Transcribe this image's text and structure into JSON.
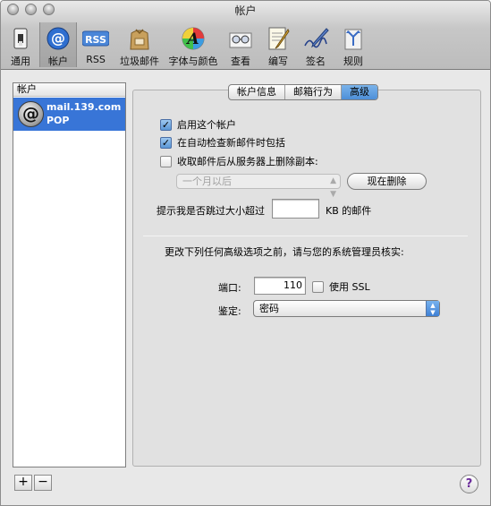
{
  "window": {
    "title": "帐户"
  },
  "toolbar": {
    "items": [
      {
        "label": "通用",
        "icon": "switch-icon"
      },
      {
        "label": "帐户",
        "icon": "at-sign-icon",
        "selected": true
      },
      {
        "label": "RSS",
        "icon": "rss-icon",
        "badge": "RSS"
      },
      {
        "label": "垃圾邮件",
        "icon": "junk-bag-icon"
      },
      {
        "label": "字体与颜色",
        "icon": "fonts-colors-icon",
        "glyph": "A"
      },
      {
        "label": "查看",
        "icon": "glasses-icon"
      },
      {
        "label": "编写",
        "icon": "compose-icon"
      },
      {
        "label": "签名",
        "icon": "signature-icon"
      },
      {
        "label": "规则",
        "icon": "rules-icon"
      }
    ]
  },
  "sidebar": {
    "header": "帐户",
    "accounts": [
      {
        "name": "mail.139.com",
        "type": "POP",
        "selected": true
      }
    ],
    "add_label": "+",
    "remove_label": "−"
  },
  "tabs": [
    {
      "label": "帐户信息",
      "active": false
    },
    {
      "label": "邮箱行为",
      "active": false
    },
    {
      "label": "高级",
      "active": true
    }
  ],
  "advanced": {
    "enable_account": {
      "label": "启用这个帐户",
      "checked": true
    },
    "include_auto_check": {
      "label": "在自动检查新邮件时包括",
      "checked": true
    },
    "remove_copy": {
      "label": "收取邮件后从服务器上删除副本:",
      "checked": false
    },
    "remove_after": {
      "value": "一个月以后",
      "disabled": true
    },
    "remove_now_label": "现在删除",
    "prompt_prefix": "提示我是否跳过大小超过",
    "size_value": "",
    "size_suffix": "KB 的邮件",
    "admin_note": "更改下列任何高级选项之前，请与您的系统管理员核实:",
    "port_label": "端口:",
    "port_value": "110",
    "ssl": {
      "label": "使用 SSL",
      "checked": false
    },
    "auth_label": "鉴定:",
    "auth_value": "密码"
  },
  "help_label": "?",
  "colors": {
    "selection": "#3875d7",
    "tab_active": "#5b9be0",
    "help_glyph": "#6a2a9a"
  }
}
